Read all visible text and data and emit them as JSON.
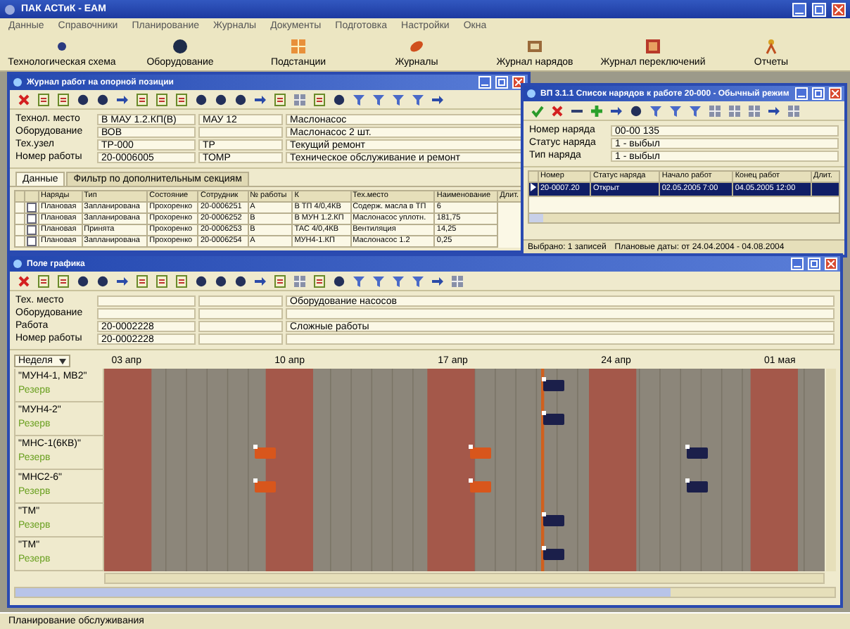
{
  "app": {
    "title": "ПАК АСТиК - ЕАМ",
    "menu": [
      "Данные",
      "Справочники",
      "Планирование",
      "Журналы",
      "Документы",
      "Подготовка",
      "Настройки",
      "Окна"
    ],
    "toolbar": [
      "Технологическая схема",
      "Оборудование",
      "Подстанции",
      "Журналы",
      "Журнал нарядов",
      "Журнал переключений",
      "Отчеты"
    ]
  },
  "work_journal": {
    "title": "Журнал работ на опорной позиции",
    "fields": [
      {
        "label": "Технол. место",
        "code": "В МАУ 1.2.КП(В)",
        "short": "МАУ 12",
        "name": "Маслонасос"
      },
      {
        "label": "Оборудование",
        "code": "ВОВ",
        "name": "Маслонасос 2 шт."
      },
      {
        "label": "Тех.узел",
        "code": "ТР-000",
        "short": "ТР",
        "name": "Текущий ремонт"
      },
      {
        "label": "Номер работы",
        "code": "20-0006005",
        "short": "ТОМР",
        "name": "Техническое обслуживание и ремонт"
      }
    ],
    "tabs": [
      {
        "label": "Данные",
        "selected": true
      },
      {
        "label": "Фильтр по дополнительным секциям",
        "selected": false
      }
    ],
    "table": {
      "columns": [
        "Наряды",
        "Тип",
        "Состояние",
        "Сотрудник",
        "№ работы",
        "К",
        "Тех.место",
        "Наименование",
        "Длит."
      ],
      "rows": [
        {
          "checked": false,
          "cells": [
            "Плановая",
            "Запланирована",
            "Прохоренко",
            "20-0006251",
            "А",
            "В ТП 4/0,4КВ",
            "Содерж. масла в ТП",
            "6"
          ]
        },
        {
          "checked": false,
          "cells": [
            "Плановая",
            "Запланирована",
            "Прохоренко",
            "20-0006252",
            "В",
            "В МУН 1.2.КП",
            "Маслонасос уплотн.",
            "181,75"
          ]
        },
        {
          "checked": false,
          "cells": [
            "Плановая",
            "Принята",
            "Прохоренко",
            "20-0006253",
            "В",
            "ТАС 4/0,4КВ",
            "Вентиляция",
            "14,25"
          ]
        },
        {
          "checked": false,
          "cells": [
            "Плановая",
            "Запланирована",
            "Прохоренко",
            "20-0006254",
            "А",
            "МУН4-1.КП",
            "Маслонасос 1.2",
            "0,25"
          ]
        }
      ]
    }
  },
  "order_list": {
    "title": "ВП 3.1.1 Список нарядов к работе 20-000 - Обычный режим",
    "fields": [
      {
        "label": "Номер наряда",
        "code": "00-00 135"
      },
      {
        "label": "Статус наряда",
        "code": "1 - выбыл"
      },
      {
        "label": "Тип наряда",
        "code": "1 - выбыл"
      }
    ],
    "table": {
      "columns": [
        "Номер",
        "Статус наряда",
        "Начало работ",
        "Конец работ",
        "Длит."
      ],
      "rows": [
        {
          "selected": true,
          "cells": [
            "20-0007.20",
            "Открыт",
            "02.05.2005 7:00",
            "04.05.2005 12:00",
            ""
          ]
        }
      ]
    },
    "footer": [
      "Выбрано: 1 записей",
      "Плановые даты: от 24.04.2004 - 04.08.2004"
    ]
  },
  "schedule": {
    "title": "Поле графика",
    "fields": [
      {
        "label": "Тех. место",
        "name": "Оборудование насосов"
      },
      {
        "label": "Оборудование"
      },
      {
        "label": "Работа",
        "code": "20-0002228",
        "name": "Сложные работы"
      },
      {
        "label": "Номер работы",
        "code": "20-0002228"
      }
    ],
    "period": "Неделя",
    "timeline": [
      "03 апр",
      "10 апр",
      "17 апр",
      "24 апр",
      "01 мая"
    ],
    "rows": [
      {
        "name": "\"МУН4-1, МВ2\"",
        "sub": "Резерв",
        "slots": [
          {
            "kind": "none"
          },
          {
            "kind": "none"
          },
          {
            "kind": "none"
          },
          {
            "kind": "none"
          },
          {
            "kind": "none"
          },
          {
            "kind": "none"
          },
          {
            "kind": "done"
          },
          {
            "kind": "none"
          },
          {
            "kind": "none"
          },
          {
            "kind": "none"
          }
        ]
      },
      {
        "name": "\"МУН4-2\"",
        "sub": "Резерв",
        "slots": [
          {
            "kind": "none"
          },
          {
            "kind": "none"
          },
          {
            "kind": "none"
          },
          {
            "kind": "none"
          },
          {
            "kind": "none"
          },
          {
            "kind": "none"
          },
          {
            "kind": "done"
          },
          {
            "kind": "none"
          },
          {
            "kind": "none"
          },
          {
            "kind": "none"
          }
        ]
      },
      {
        "name": "\"МНС-1(6КВ)\"",
        "sub": "Резерв",
        "slots": [
          {
            "kind": "none"
          },
          {
            "kind": "none"
          },
          {
            "kind": "planned"
          },
          {
            "kind": "none"
          },
          {
            "kind": "none"
          },
          {
            "kind": "planned"
          },
          {
            "kind": "none"
          },
          {
            "kind": "none"
          },
          {
            "kind": "done"
          },
          {
            "kind": "none"
          }
        ]
      },
      {
        "name": "\"МНС2-6\"",
        "sub": "Резерв",
        "slots": [
          {
            "kind": "none"
          },
          {
            "kind": "none"
          },
          {
            "kind": "planned"
          },
          {
            "kind": "none"
          },
          {
            "kind": "none"
          },
          {
            "kind": "planned"
          },
          {
            "kind": "none"
          },
          {
            "kind": "none"
          },
          {
            "kind": "done"
          },
          {
            "kind": "none"
          }
        ]
      },
      {
        "name": "\"ТМ\"",
        "sub": "Резерв",
        "slots": [
          {
            "kind": "none"
          },
          {
            "kind": "none"
          },
          {
            "kind": "none"
          },
          {
            "kind": "none"
          },
          {
            "kind": "none"
          },
          {
            "kind": "none"
          },
          {
            "kind": "done"
          },
          {
            "kind": "none"
          },
          {
            "kind": "none"
          },
          {
            "kind": "none"
          }
        ]
      },
      {
        "name": "\"ТМ\"",
        "sub": "Резерв",
        "slots": [
          {
            "kind": "none"
          },
          {
            "kind": "none"
          },
          {
            "kind": "none"
          },
          {
            "kind": "none"
          },
          {
            "kind": "none"
          },
          {
            "kind": "none"
          },
          {
            "kind": "done"
          },
          {
            "kind": "none"
          },
          {
            "kind": "none"
          },
          {
            "kind": "none"
          }
        ]
      }
    ]
  },
  "status_bar": "Планирование обслуживания"
}
